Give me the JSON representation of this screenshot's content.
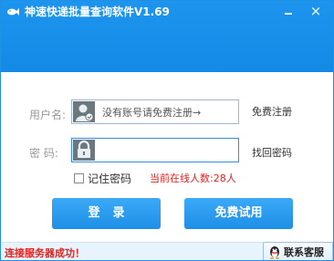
{
  "window": {
    "title": "神速快递批量查询软件V1.69"
  },
  "window_controls": {
    "minimize_label": "",
    "close_label": "×"
  },
  "username": {
    "label": "用户名:",
    "placeholder": "没有账号请免费注册→",
    "link": "免费注册"
  },
  "password": {
    "label": "密  码:",
    "value": "",
    "link": "找回密码"
  },
  "remember": {
    "label": "记住密码",
    "checked": false
  },
  "online": {
    "text": "当前在线人数:28人"
  },
  "buttons": {
    "login": "登录",
    "trial": "免费试用"
  },
  "status": {
    "text": "连接服务器成功！"
  },
  "service": {
    "label": "联系客服"
  },
  "colors": {
    "title_bar": "#148ae6",
    "button": "#1e8fe7",
    "status_text": "#e32321"
  },
  "icons": {
    "app": "fish-icon",
    "user": "user-avatar-icon",
    "lock": "lock-icon",
    "qq": "qq-penguin-icon"
  }
}
